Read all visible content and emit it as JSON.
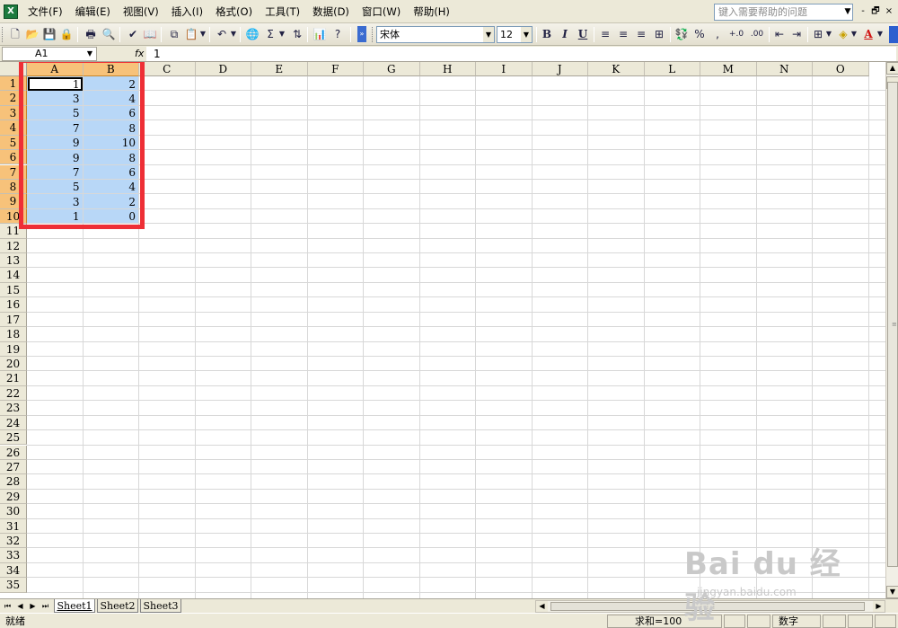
{
  "menu": [
    "文件(F)",
    "编辑(E)",
    "视图(V)",
    "插入(I)",
    "格式(O)",
    "工具(T)",
    "数据(D)",
    "窗口(W)",
    "帮助(H)"
  ],
  "help_box": {
    "placeholder": "键入需要帮助的问题"
  },
  "window_buttons": [
    "-",
    "🗗",
    "×"
  ],
  "toolbar": {
    "font_name": "宋体",
    "font_size": "12",
    "bold": "B",
    "italic": "I",
    "underline": "U",
    "percent": "%",
    "comma": ",",
    "increase_decimal": "+.0",
    "decrease_decimal": ".00",
    "sum": "Σ"
  },
  "formula_bar": {
    "name_box": "A1",
    "fx": "fx",
    "value": "1"
  },
  "columns": [
    "A",
    "B",
    "C",
    "D",
    "E",
    "F",
    "G",
    "H",
    "I",
    "J",
    "K",
    "L",
    "M",
    "N",
    "O"
  ],
  "rows": [
    "1",
    "2",
    "3",
    "4",
    "5",
    "6",
    "7",
    "8",
    "9",
    "10",
    "11",
    "12",
    "13",
    "14",
    "15",
    "16",
    "17",
    "18",
    "19",
    "20",
    "21",
    "22",
    "23",
    "24",
    "25",
    "26",
    "27",
    "28",
    "29",
    "30",
    "31",
    "32",
    "33",
    "34",
    "35"
  ],
  "cells": {
    "A": [
      "1",
      "3",
      "5",
      "7",
      "9",
      "9",
      "7",
      "5",
      "3",
      "1"
    ],
    "B": [
      "2",
      "4",
      "6",
      "8",
      "10",
      "8",
      "6",
      "4",
      "2",
      "0"
    ]
  },
  "sheet_tabs": [
    "Sheet1",
    "Sheet2",
    "Sheet3"
  ],
  "status": {
    "ready": "就绪",
    "sum": "求和=100",
    "mode": "数字"
  },
  "watermark": {
    "main": "Bai du 经验",
    "sub": "jingyan.baidu.com"
  },
  "colors": {
    "selection": "#b8d7f7",
    "header_selected": "#f7c27a",
    "highlight_box": "#ee2f36"
  }
}
